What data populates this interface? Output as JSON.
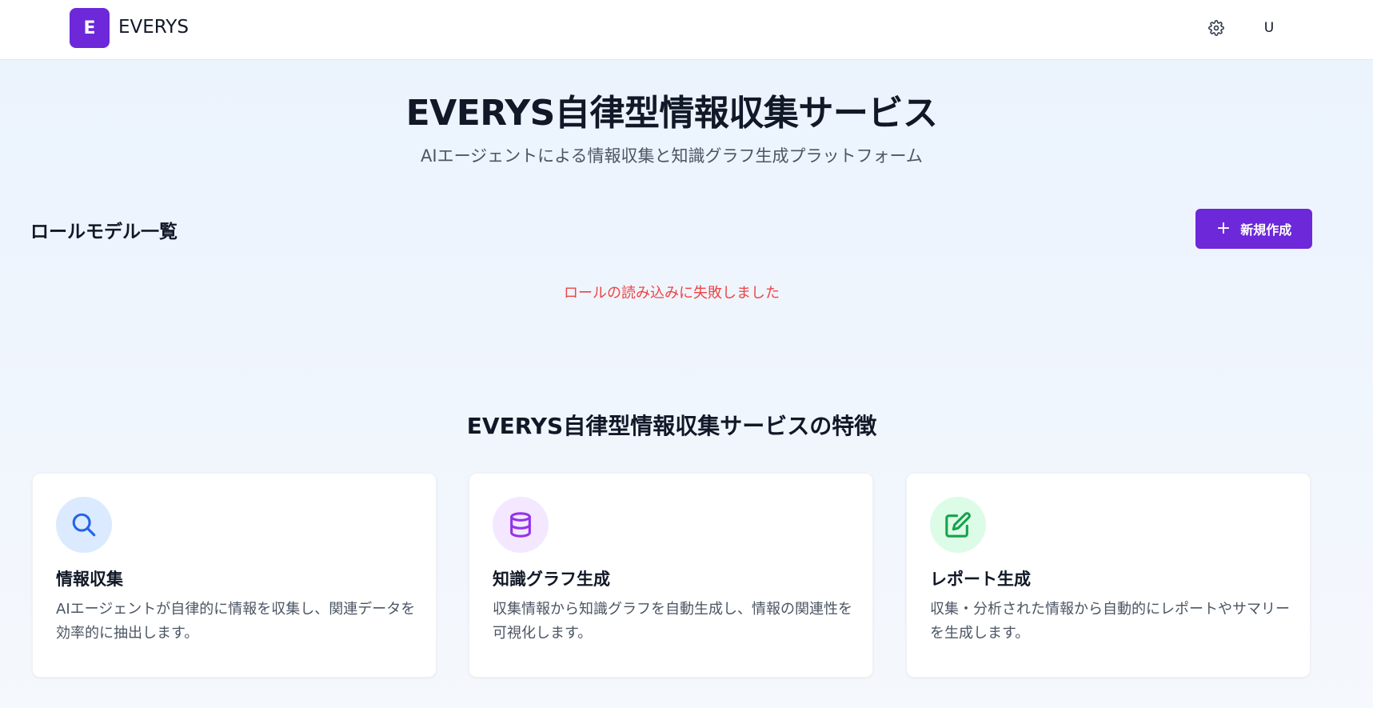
{
  "header": {
    "logo_letter": "E",
    "brand": "EVERYS",
    "settings_icon": "gear-icon",
    "user_initial": "U"
  },
  "hero": {
    "title": "EVERYS自律型情報収集サービス",
    "subtitle": "AIエージェントによる情報収集と知識グラフ生成プラットフォーム"
  },
  "roles": {
    "title": "ロールモデル一覧",
    "new_button_label": "新規作成",
    "new_button_icon": "plus-icon",
    "error_message": "ロールの読み込みに失敗しました"
  },
  "features": {
    "title": "EVERYS自律型情報収集サービスの特徴",
    "cards": [
      {
        "icon": "search-icon",
        "title": "情報収集",
        "description": "AIエージェントが自律的に情報を収集し、関連データを効率的に抽出します。"
      },
      {
        "icon": "database-icon",
        "title": "知識グラフ生成",
        "description": "収集情報から知識グラフを自動生成し、情報の関連性を可視化します。"
      },
      {
        "icon": "edit-icon",
        "title": "レポート生成",
        "description": "収集・分析された情報から自動的にレポートやサマリーを生成します。"
      }
    ]
  },
  "colors": {
    "brand": "#6d28d9",
    "error": "#ef4444",
    "search_icon": "#2563eb",
    "database_icon": "#9333ea",
    "edit_icon": "#16a34a"
  }
}
